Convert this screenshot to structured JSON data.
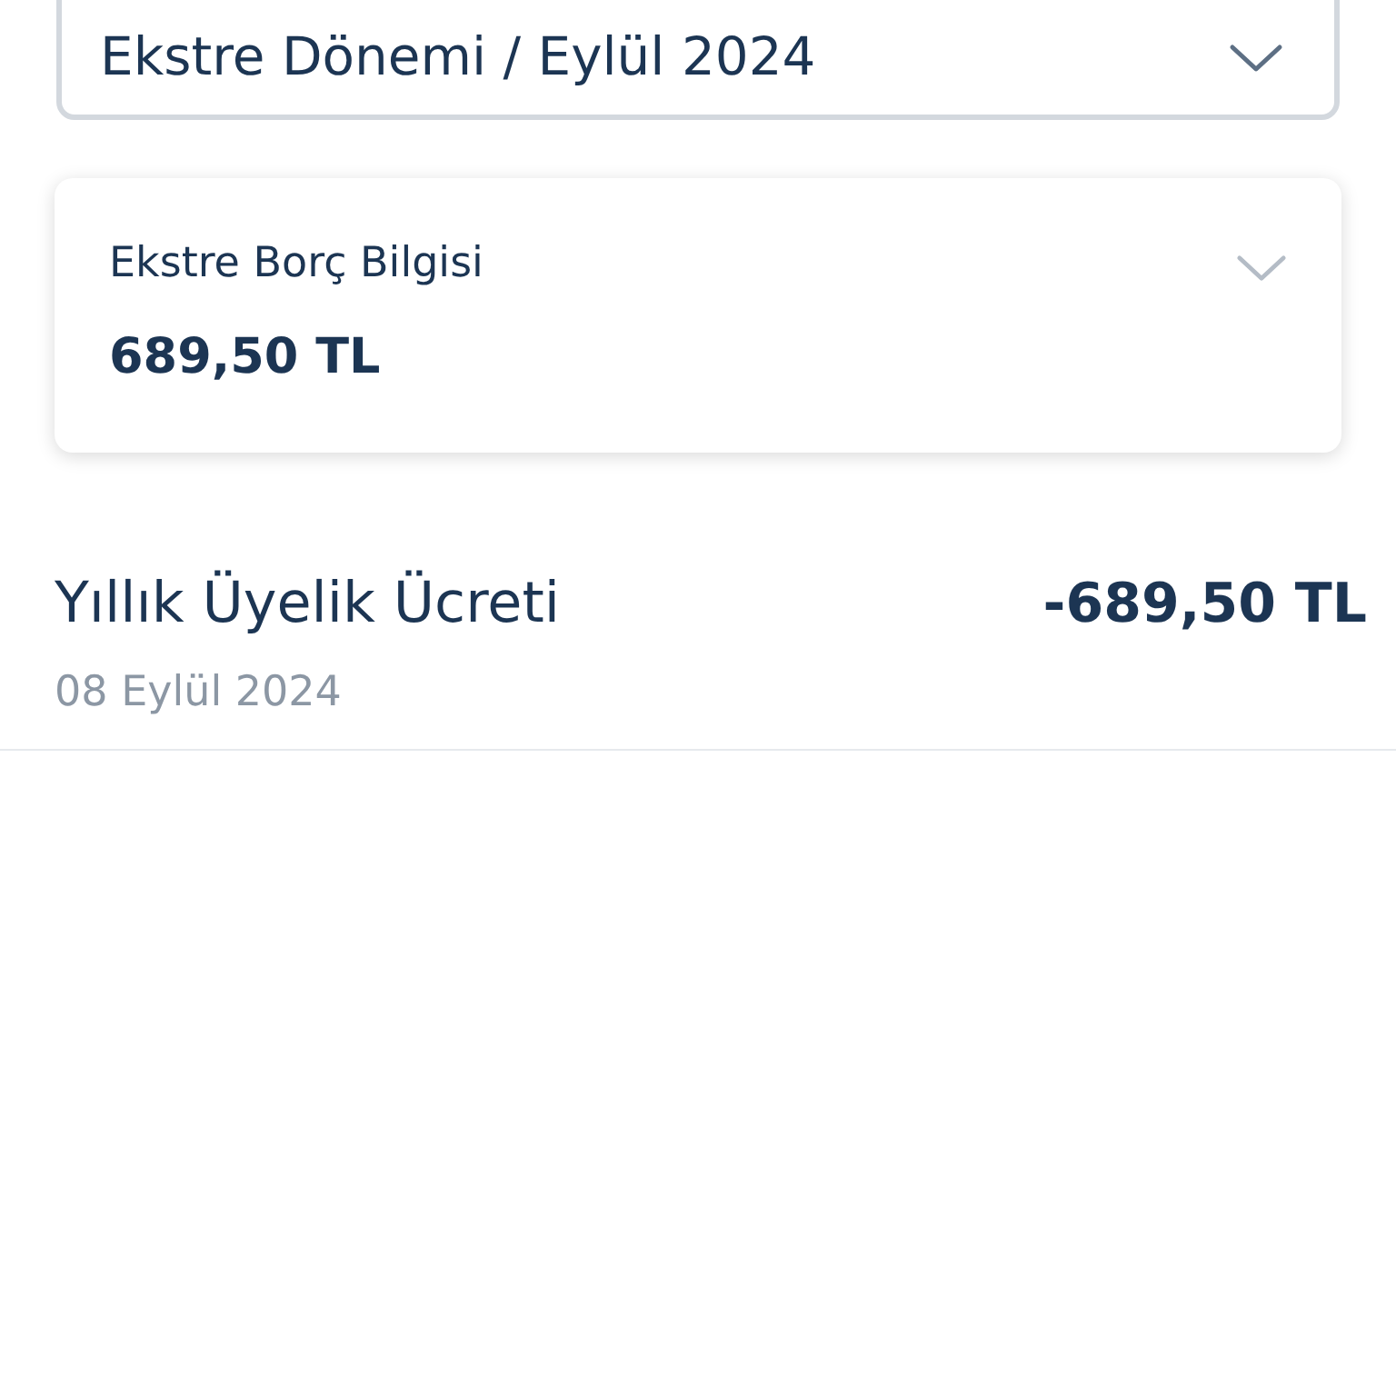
{
  "period_dropdown": {
    "value": "Ekstre Dönemi / Eylül 2024"
  },
  "statement_card": {
    "label": "Ekstre Borç Bilgisi",
    "amount": "689,50 TL"
  },
  "transactions": [
    {
      "title": "Yıllık Üyelik Ücreti",
      "amount": "-689,50 TL",
      "date": "08 Eylül 2024"
    }
  ]
}
